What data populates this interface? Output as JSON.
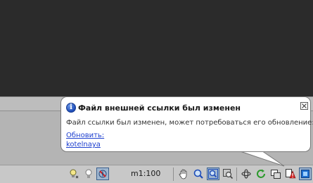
{
  "balloon": {
    "title": "Файл внешней ссылки был изменен",
    "message": "Файл ссылки был изменен, может потребоваться его обновление:",
    "update_link": "Обновить:",
    "file_link": "kotelnaya"
  },
  "statusbar": {
    "scale": "m1:100",
    "icons": [
      "light-bulb-settings-icon",
      "light-bulb-icon",
      "compass-disabled-icon",
      "pan-hand-icon",
      "zoom-magnifier-icon",
      "zoom-window-icon",
      "zoom-previous-icon",
      "orbit-icon",
      "refresh-regen-icon",
      "viewport-copy-icon",
      "xref-alert-icon",
      "fullscreen-icon"
    ]
  },
  "colors": {
    "canvas_background": "#2b2b2b",
    "balloon_background": "#ffffff",
    "link": "#1d3fcf",
    "alert_red": "#d42020"
  }
}
